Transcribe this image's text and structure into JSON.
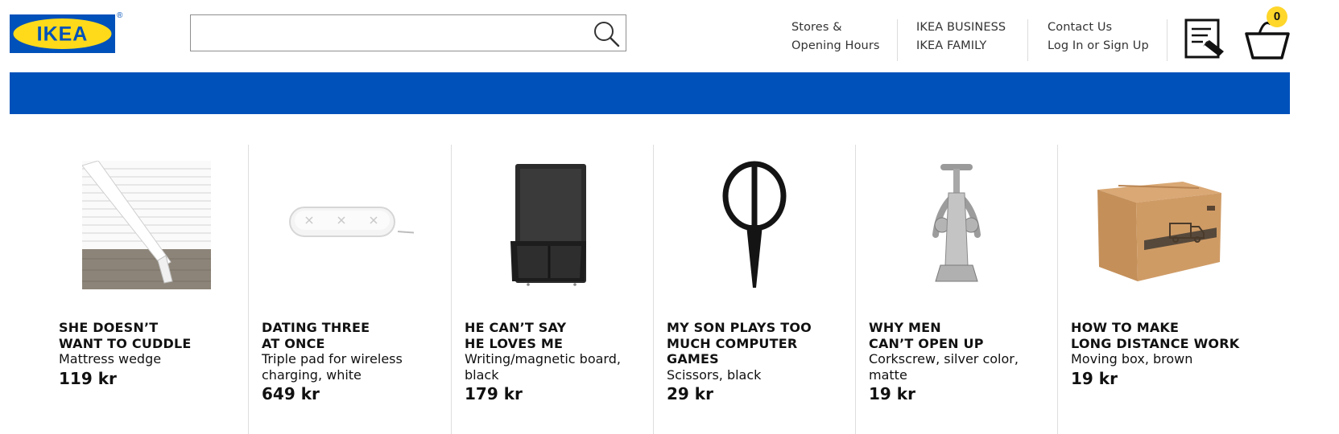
{
  "header": {
    "logo_text": "IKEA",
    "logo_mark": "®",
    "search": {
      "value": "",
      "placeholder": ""
    },
    "nav": {
      "stores": "Stores &",
      "opening_hours": "Opening Hours",
      "business": "IKEA BUSINESS",
      "family": "IKEA FAMILY",
      "contact": "Contact Us",
      "login": "Log In or Sign Up"
    },
    "cart_count": "0"
  },
  "colors": {
    "brand_blue": "#0051ba",
    "brand_yellow": "#ffda1a",
    "badge_yellow": "#ffd62a"
  },
  "products": [
    {
      "title": "SHE DOESN’T\nWANT TO CUDDLE",
      "desc": "Mattress wedge",
      "price": "119 kr",
      "image": "mattress-wedge-image"
    },
    {
      "title": "DATING THREE\nAT ONCE",
      "desc": "Triple pad for wireless\ncharging, white",
      "price": "649 kr",
      "image": "wireless-charger-image"
    },
    {
      "title": "HE CAN’T SAY\nHE LOVES ME",
      "desc": "Writing/magnetic board,\nblack",
      "price": "179 kr",
      "image": "magnetic-board-image"
    },
    {
      "title": "MY SON PLAYS TOO\nMUCH COMPUTER\nGAMES",
      "desc": "Scissors, black",
      "price": "29 kr",
      "image": "scissors-image"
    },
    {
      "title": "WHY MEN\nCAN’T OPEN UP",
      "desc": "Corkscrew, silver color,\nmatte",
      "price": "19 kr",
      "image": "corkscrew-image"
    },
    {
      "title": "HOW TO MAKE\nLONG DISTANCE WORK",
      "desc": "Moving box, brown",
      "price": "19 kr",
      "image": "moving-box-image"
    }
  ]
}
